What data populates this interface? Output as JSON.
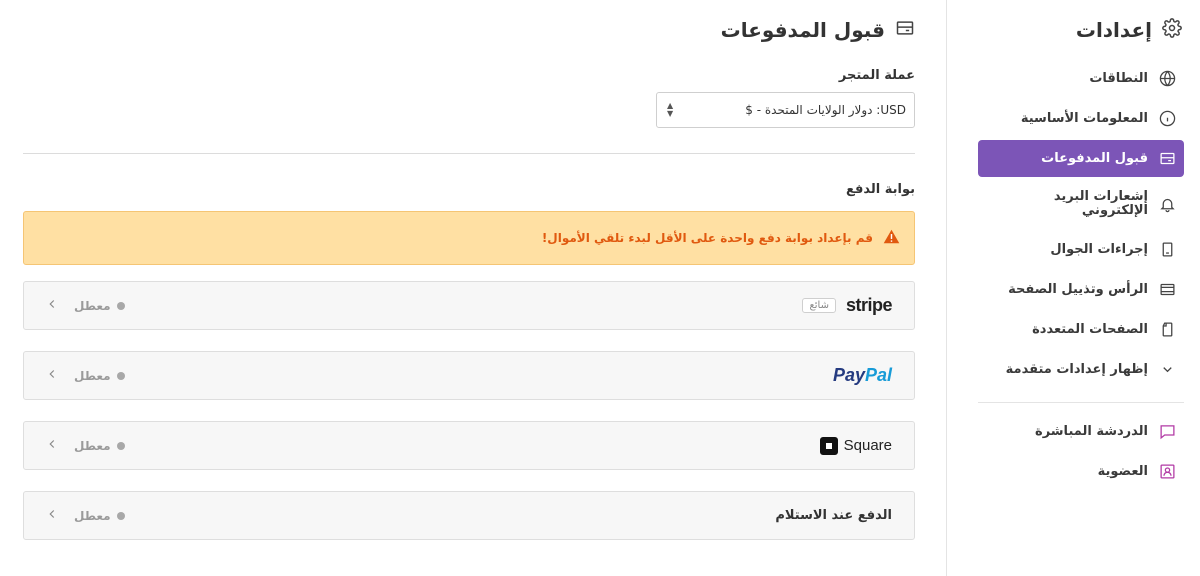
{
  "sidebar": {
    "title": "إعدادات",
    "title_icon": "gear-icon",
    "items": [
      {
        "label": "النطاقات",
        "icon": "globe-icon",
        "active": false
      },
      {
        "label": "المعلومات الأساسية",
        "icon": "info-icon",
        "active": false
      },
      {
        "label": "قبول المدفوعات",
        "icon": "payment-card-icon",
        "active": true
      },
      {
        "label": "إشعارات البريد الإلكتروني",
        "icon": "bell-icon",
        "active": false
      },
      {
        "label": "إجراءات الجوال",
        "icon": "mobile-icon",
        "active": false
      },
      {
        "label": "الرأس وتذييل الصفحة",
        "icon": "layout-icon",
        "active": false
      },
      {
        "label": "الصفحات المتعددة",
        "icon": "pages-icon",
        "active": false
      },
      {
        "label": "إظهار إعدادات متقدمة",
        "icon": "chevron-down-icon",
        "active": false
      }
    ],
    "extra_items": [
      {
        "label": "الدردشة المباشرة",
        "icon": "chat-icon"
      },
      {
        "label": "العضوية",
        "icon": "member-icon"
      }
    ]
  },
  "main": {
    "title": "قبول المدفوعات",
    "title_icon": "payment-card-icon",
    "currency": {
      "label": "عملة المتجر",
      "value": "USD: دولار الولايات المتحدة - $"
    },
    "gateway_section_label": "بوابة الدفع",
    "warning": "قم بإعداد بوابة دفع واحدة على الأقل لبدء تلقي الأموال!",
    "gateways": [
      {
        "name": "stripe",
        "badge": "شائع",
        "status": "معطل"
      },
      {
        "name": "PayPal",
        "status": "معطل"
      },
      {
        "name": "Square",
        "status": "معطل"
      },
      {
        "name": "الدفع عند الاستلام",
        "status": "معطل"
      }
    ]
  },
  "colors": {
    "accent": "#7c55b7",
    "warning_bg": "#ffe0a3",
    "warning_text": "#e0590f",
    "paypal_dark": "#253b80",
    "paypal_light": "#179bd7",
    "extra_icon": "#b23aa5"
  }
}
